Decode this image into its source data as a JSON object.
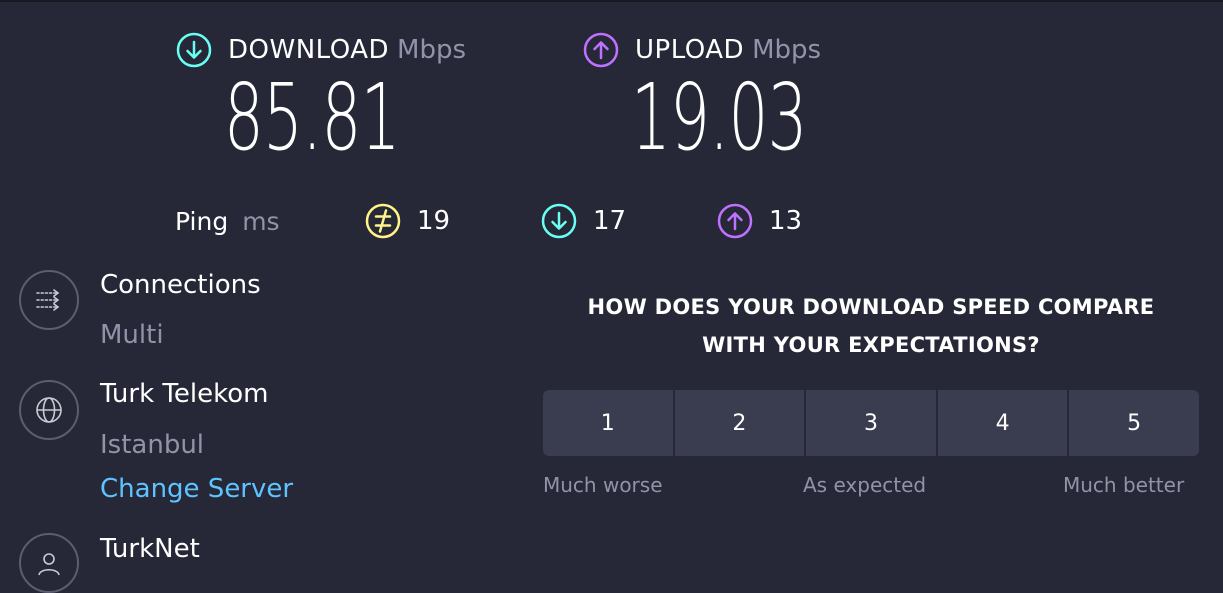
{
  "download": {
    "label": "DOWNLOAD",
    "unit": "Mbps",
    "value": "85.81"
  },
  "upload": {
    "label": "UPLOAD",
    "unit": "Mbps",
    "value": "19.03"
  },
  "ping": {
    "label": "Ping",
    "unit": "ms",
    "idle": "19",
    "download": "17",
    "upload": "13"
  },
  "connections": {
    "title": "Connections",
    "value": "Multi"
  },
  "server": {
    "name": "Turk Telekom",
    "location": "Istanbul",
    "change_label": "Change Server"
  },
  "provider": {
    "name": "TurkNet"
  },
  "survey": {
    "question_line1": "HOW DOES YOUR DOWNLOAD SPEED COMPARE",
    "question_line2": "WITH YOUR EXPECTATIONS?",
    "options": [
      "1",
      "2",
      "3",
      "4",
      "5"
    ],
    "scale_low": "Much worse",
    "scale_mid": "As expected",
    "scale_high": "Much better"
  },
  "colors": {
    "background": "#262837",
    "download_accent": "#6afff3",
    "upload_accent": "#bf71ff",
    "ping_accent": "#fff38a",
    "link": "#5ec3ff",
    "muted": "#9193a8"
  }
}
